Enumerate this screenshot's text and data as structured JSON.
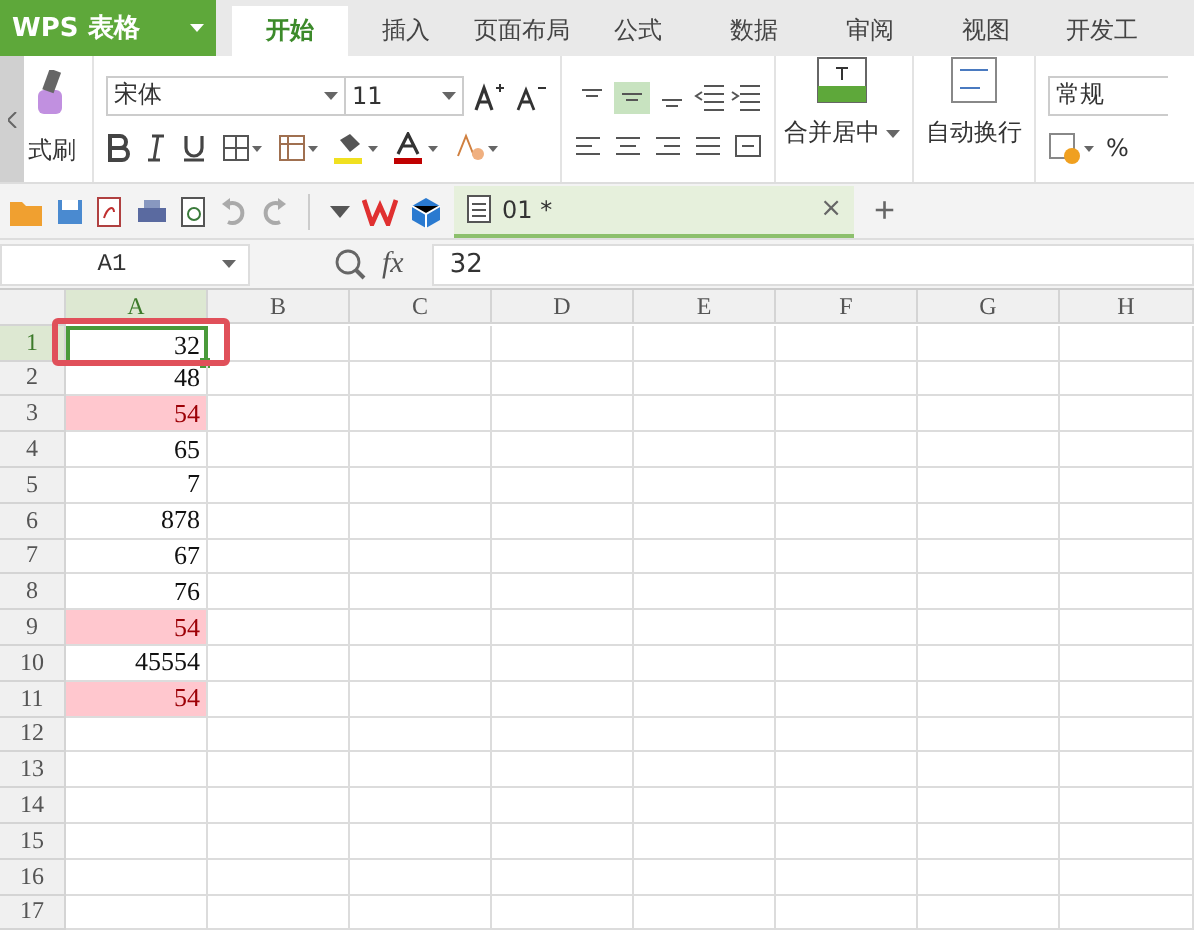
{
  "app_menu": {
    "label": "WPS 表格"
  },
  "tabs": [
    {
      "label": "开始",
      "selected": true
    },
    {
      "label": "插入",
      "selected": false
    },
    {
      "label": "页面布局",
      "selected": false
    },
    {
      "label": "公式",
      "selected": false
    },
    {
      "label": "数据",
      "selected": false
    },
    {
      "label": "审阅",
      "selected": false
    },
    {
      "label": "视图",
      "selected": false
    },
    {
      "label": "开发工",
      "selected": false
    }
  ],
  "ribbon": {
    "format_painter": "式刷",
    "font": "宋体",
    "font_size": "11",
    "merge": "合并居中",
    "wrap": "自动换行",
    "number_format": "常规",
    "percent": "%",
    "align_buttons": [
      {
        "selected": false
      },
      {
        "selected": true
      },
      {
        "selected": false
      }
    ]
  },
  "document_tab": {
    "label": "01 *",
    "close": "×",
    "add": "+"
  },
  "formula_bar": {
    "name_box": "A1",
    "fx": "fx",
    "value": "32"
  },
  "sheet": {
    "columns": [
      "A",
      "B",
      "C",
      "D",
      "E",
      "F",
      "G",
      "H"
    ],
    "rows": [
      {
        "number": "1",
        "value": "32",
        "highlighted": false,
        "selected": true
      },
      {
        "number": "2",
        "value": "48",
        "highlighted": false,
        "selected": false
      },
      {
        "number": "3",
        "value": "54",
        "highlighted": true,
        "selected": false
      },
      {
        "number": "4",
        "value": "65",
        "highlighted": false,
        "selected": false
      },
      {
        "number": "5",
        "value": "7",
        "highlighted": false,
        "selected": false
      },
      {
        "number": "6",
        "value": "878",
        "highlighted": false,
        "selected": false
      },
      {
        "number": "7",
        "value": "67",
        "highlighted": false,
        "selected": false
      },
      {
        "number": "8",
        "value": "76",
        "highlighted": false,
        "selected": false
      },
      {
        "number": "9",
        "value": "54",
        "highlighted": true,
        "selected": false
      },
      {
        "number": "10",
        "value": "45554",
        "highlighted": false,
        "selected": false
      },
      {
        "number": "11",
        "value": "54",
        "highlighted": true,
        "selected": false
      },
      {
        "number": "12"
      },
      {
        "number": "13"
      },
      {
        "number": "14"
      },
      {
        "number": "15"
      },
      {
        "number": "16"
      },
      {
        "number": "17"
      }
    ]
  }
}
